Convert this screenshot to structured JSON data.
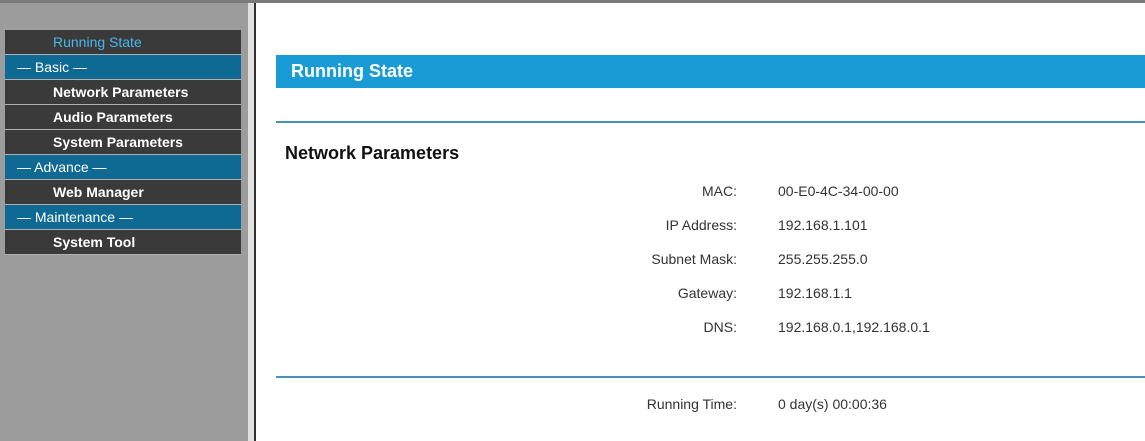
{
  "sidebar": {
    "items": [
      {
        "label": "Running State",
        "kind": "active"
      },
      {
        "label": "— Basic —",
        "kind": "group"
      },
      {
        "label": "Network Parameters",
        "kind": "link"
      },
      {
        "label": "Audio Parameters",
        "kind": "link"
      },
      {
        "label": "System Parameters",
        "kind": "link"
      },
      {
        "label": "— Advance —",
        "kind": "group"
      },
      {
        "label": "Web Manager",
        "kind": "link"
      },
      {
        "label": "— Maintenance —",
        "kind": "group"
      },
      {
        "label": "System Tool",
        "kind": "link"
      }
    ]
  },
  "main": {
    "title": "Running State",
    "section_title": "Network Parameters",
    "network": {
      "mac_label": "MAC:",
      "mac_value": "00-E0-4C-34-00-00",
      "ip_label": "IP Address:",
      "ip_value": "192.168.1.101",
      "subnet_label": "Subnet Mask:",
      "subnet_value": "255.255.255.0",
      "gateway_label": "Gateway:",
      "gateway_value": "192.168.1.1",
      "dns_label": "DNS:",
      "dns_value": "192.168.0.1,192.168.0.1"
    },
    "running_time_label": "Running Time:",
    "running_time_value": "0 day(s) 00:00:36"
  },
  "colors": {
    "accent": "#1a9bd5",
    "menu_group": "#0e6a92",
    "menu_item": "#3a3a3a",
    "active_text": "#47b8ec"
  }
}
